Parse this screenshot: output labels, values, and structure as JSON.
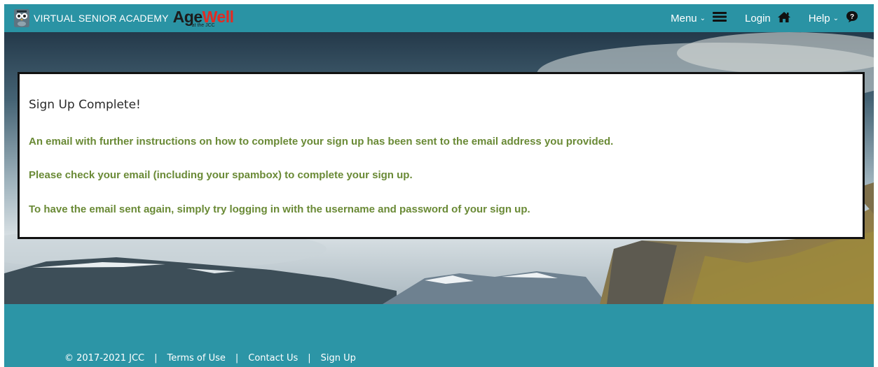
{
  "header": {
    "brand_name": "VIRTUAL SENIOR ACADEMY",
    "logo_age": "Age",
    "logo_well": "Well",
    "logo_sub": "at the JCC",
    "menu_label": "Menu",
    "login_label": "Login",
    "help_label": "Help"
  },
  "panel": {
    "title": "Sign Up Complete!",
    "message_1": "An email with further instructions on how to complete your sign up has been sent to the email address you provided.",
    "message_2": "Please check your email (including your spambox) to complete your sign up.",
    "message_3": "To have the email sent again, simply try logging in with the username and password of your sign up."
  },
  "footer": {
    "copyright": "© 2017-2021 JCC",
    "separator": "|",
    "terms": "Terms of Use",
    "contact": "Contact Us",
    "signup": "Sign Up"
  },
  "icons": {
    "owl": "owl-logo-icon",
    "menu": "hamburger-icon",
    "login": "home-icon",
    "help": "help-icon",
    "chevron": "chevron-down-icon"
  },
  "colors": {
    "header_bg": "#2a93a4",
    "page_bg": "#2c95a6",
    "message_green": "#6a8a36",
    "logo_red": "#e32a22"
  }
}
